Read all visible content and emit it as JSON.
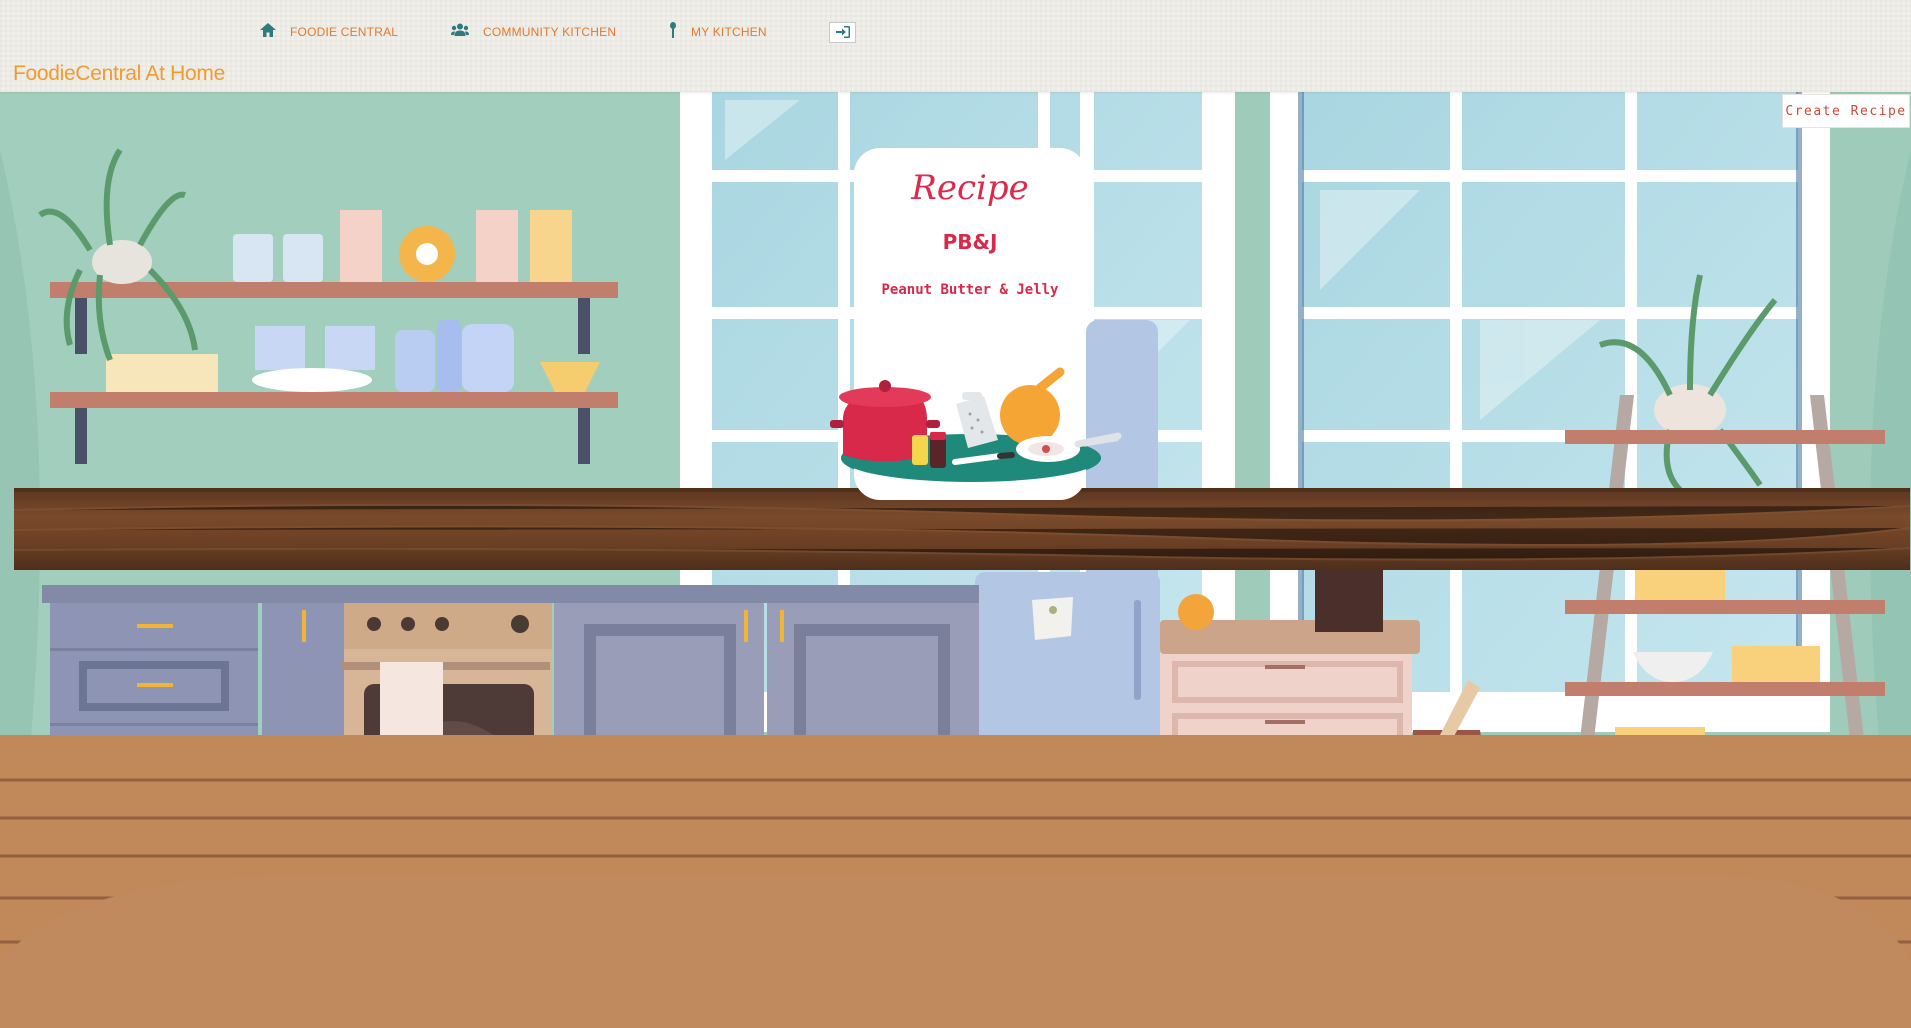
{
  "nav": {
    "items": [
      {
        "label": "FOODIE CENTRAL",
        "icon": "home-icon"
      },
      {
        "label": "COMMUNITY KITCHEN",
        "icon": "users-icon"
      },
      {
        "label": "MY KITCHEN",
        "icon": "spoon-icon"
      }
    ],
    "login_icon": "sign-in-icon"
  },
  "brand": {
    "title": "FoodieCentral At Home"
  },
  "actions": {
    "create_recipe": "Create Recipe"
  },
  "recipe_card": {
    "heading": "Recipe",
    "name": "PB&J",
    "description": "Peanut Butter & Jelly"
  },
  "colors": {
    "nav_text": "#e07a2e",
    "nav_icon": "#2e7a80",
    "brand": "#f29a2e",
    "recipe_accent": "#d8294a",
    "wall": "#9fcbbb",
    "counter": "#6b4327",
    "floor": "#c1885a"
  }
}
